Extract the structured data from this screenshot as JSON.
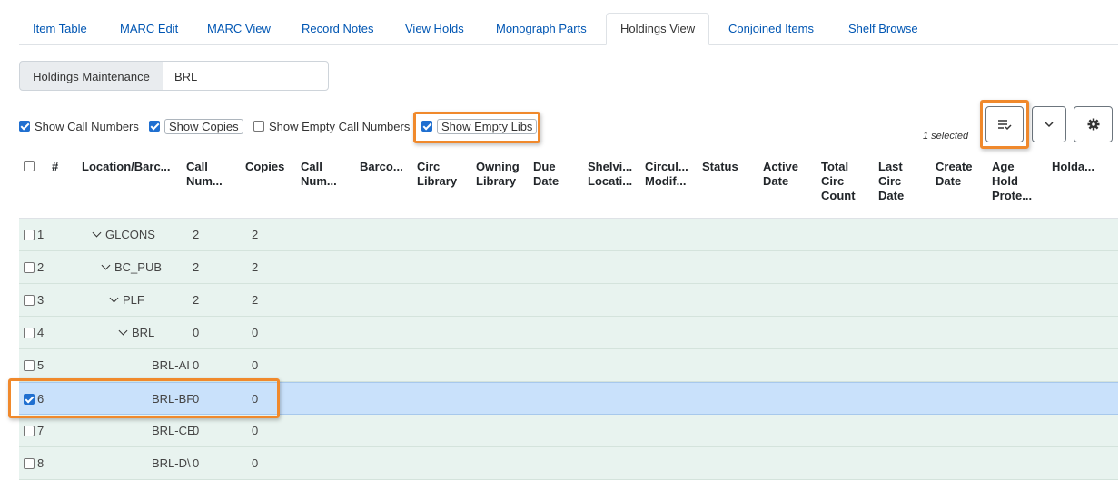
{
  "tabs": [
    {
      "label": "Item Table",
      "active": false
    },
    {
      "label": "MARC Edit",
      "active": false
    },
    {
      "label": "MARC View",
      "active": false
    },
    {
      "label": "Record Notes",
      "active": false
    },
    {
      "label": "View Holds",
      "active": false
    },
    {
      "label": "Monograph Parts",
      "active": false
    },
    {
      "label": "Holdings View",
      "active": true
    },
    {
      "label": "Conjoined Items",
      "active": false
    },
    {
      "label": "Shelf Browse",
      "active": false
    }
  ],
  "holdings": {
    "label": "Holdings Maintenance",
    "value": "BRL"
  },
  "options": {
    "show_call_numbers": {
      "label": "Show Call Numbers",
      "checked": true
    },
    "show_copies": {
      "label": "Show Copies",
      "checked": true
    },
    "show_empty_call_numbers": {
      "label": "Show Empty Call Numbers",
      "checked": false
    },
    "show_empty_libs": {
      "label": "Show Empty Libs",
      "checked": true
    }
  },
  "toolbar": {
    "selected_text": "1 selected"
  },
  "columns": {
    "num": "#",
    "location": "Location/Barc...",
    "call_num": [
      "Call",
      "Num..."
    ],
    "copies": "Copies",
    "call_num2": [
      "Call",
      "Num..."
    ],
    "barcode": "Barco...",
    "circ_library": [
      "Circ",
      "Library"
    ],
    "owning_library": [
      "Owning",
      "Library"
    ],
    "due_date": [
      "Due",
      "Date"
    ],
    "shelving": [
      "Shelvi...",
      "Locati..."
    ],
    "circ_modifier": [
      "Circul...",
      "Modif..."
    ],
    "status": "Status",
    "active_date": [
      "Active",
      "Date"
    ],
    "total_circ": [
      "Total",
      "Circ",
      "Count"
    ],
    "last_circ": [
      "Last",
      "Circ",
      "Date"
    ],
    "create_date": [
      "Create",
      "Date"
    ],
    "age_hold": [
      "Age",
      "Hold",
      "Prote..."
    ],
    "holdable": "Holda..."
  },
  "rows": [
    {
      "num": "1",
      "location": "GLCONS",
      "expand": true,
      "indent": 0,
      "call_num": "2",
      "copies": "2",
      "checked": false
    },
    {
      "num": "2",
      "location": "BC_PUB",
      "expand": true,
      "indent": 1,
      "call_num": "2",
      "copies": "2",
      "checked": false
    },
    {
      "num": "3",
      "location": "PLF",
      "expand": true,
      "indent": 2,
      "call_num": "2",
      "copies": "2",
      "checked": false
    },
    {
      "num": "4",
      "location": "BRL",
      "expand": true,
      "indent": 3,
      "call_num": "0",
      "copies": "0",
      "checked": false
    },
    {
      "num": "5",
      "location": "BRL-AI",
      "expand": false,
      "indent": 4,
      "call_num": "0",
      "copies": "0",
      "checked": false
    },
    {
      "num": "6",
      "location": "BRL-BF",
      "expand": false,
      "indent": 4,
      "call_num": "0",
      "copies": "0",
      "checked": true
    },
    {
      "num": "7",
      "location": "BRL-CE",
      "expand": false,
      "indent": 4,
      "call_num": "0",
      "copies": "0",
      "checked": false
    },
    {
      "num": "8",
      "location": "BRL-D\\",
      "expand": false,
      "indent": 4,
      "call_num": "0",
      "copies": "0",
      "checked": false
    }
  ],
  "colors": {
    "accent": "#1f6fd0",
    "highlight": "#f0892c",
    "row_bg": "#e8f3ef",
    "row_selected": "#c9e1fb"
  }
}
